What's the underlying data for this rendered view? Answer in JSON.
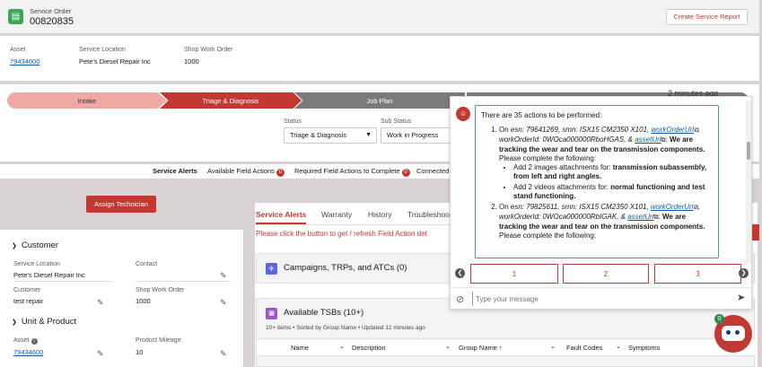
{
  "header": {
    "object_type": "Service Order",
    "number": "00820835",
    "create_report_label": "Create Service Report"
  },
  "highlights": {
    "asset_label": "Asset",
    "asset_value": "79434600",
    "location_label": "Service Location",
    "location_value": "Pete's Diesel Repair Inc",
    "swo_label": "Shop Work Order",
    "swo_value": "1000"
  },
  "path": {
    "steps": [
      "Intake",
      "Triage & Diagnosis",
      "Job Plan"
    ],
    "time_ago": "2 minutes ago"
  },
  "status": {
    "status_label": "Status",
    "status_value": "Triage & Diagnosis",
    "substatus_label": "Sub Status",
    "substatus_value": "Work in Progress"
  },
  "alerts_bar": {
    "service_alerts": "Service Alerts",
    "available_field_actions": "Available Field Actions",
    "available_count": "0",
    "required_field_actions": "Required Field Actions to Complete",
    "required_count": "0",
    "connected": "Connected"
  },
  "assign_technician_label": "Assign Technician",
  "customer_section": {
    "title": "Customer",
    "service_location_label": "Service Location",
    "service_location_value": "Pete's Diesel Repair Inc",
    "contact_label": "Contact",
    "contact_value": "",
    "customer_label": "Customer",
    "customer_value": "test repair",
    "swo_label": "Shop Work Order",
    "swo_value": "1000"
  },
  "unit_section": {
    "title": "Unit & Product",
    "asset_label": "Asset",
    "asset_value": "79434600",
    "mileage_label": "Product Mileage",
    "mileage_value": "10"
  },
  "tabs": [
    "Service Alerts",
    "Warranty",
    "History",
    "Troubleshoo"
  ],
  "refresh_message": "Please click the button to get / refresh Field Action det",
  "campaigns": {
    "title": "Campaigns, TRPs, and ATCs (0)"
  },
  "tsbs": {
    "title": "Available TSBs (10+)",
    "subtitle": "10+ items • Sorted by Group Name • Updated 12 minutes ago",
    "columns": [
      "Name",
      "Description",
      "Group Name ↑",
      "Fault Codes",
      "Symptoms"
    ]
  },
  "chat": {
    "intro": "There are 35 actions to be performed:",
    "items": [
      {
        "lead": "On ",
        "esn_label": "esn: ",
        "esn": "79641269",
        "smn_label": ", smn: ",
        "smn": "ISX15 CM2350 X101",
        "work_order_link": "workOrderUrl",
        "work_order_label": ", workOrderId: ",
        "work_order_id": "0WOca000000RboHGAS",
        "amp": ", & ",
        "asset_link": "assetUrl",
        "tracking": "We are tracking the wear and tear on the transmission components.",
        "complete": " Please complete the following:",
        "sub": [
          {
            "pre": "Add 2 images attachments for: ",
            "bold": "transmission subassembly, from left and right angles."
          },
          {
            "pre": "Add 2 videos attachments for: ",
            "bold": "normal functioning and test stand functioning."
          }
        ]
      },
      {
        "lead": "On ",
        "esn_label": "esn: ",
        "esn": "79825611",
        "smn_label": ", smn: ",
        "smn": "ISX15 CM2350 X101",
        "work_order_link": "workOrderUrl",
        "work_order_label": ", workOrderId: ",
        "work_order_id": "0WOca000000RbIGAK",
        "amp": ", & ",
        "asset_link": "assetUrl",
        "tracking": "We are tracking the wear and tear on the transmission components.",
        "complete": " Please complete the following:"
      }
    ],
    "quick_replies": [
      "1",
      "2",
      "3"
    ],
    "input_placeholder": "Type your message",
    "bot_badge": "0"
  },
  "colors": {
    "brand_red": "#c23934",
    "path_complete": "#f0a8a5",
    "path_inactive": "#7a7a7a",
    "link": "#0b5cab"
  }
}
